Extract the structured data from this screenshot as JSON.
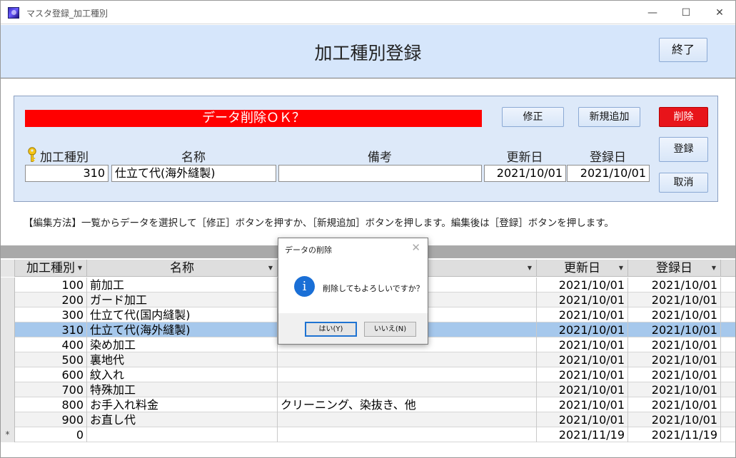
{
  "window": {
    "title": "マスタ登録_加工種別",
    "minimize": "—",
    "maximize": "☐",
    "close": "✕"
  },
  "header": {
    "title": "加工種別登録",
    "end_button": "終了"
  },
  "edit": {
    "status": "データ削除ＯＫ？",
    "buttons": {
      "fix": "修正",
      "new": "新規追加",
      "delete": "削除",
      "register": "登録",
      "cancel": "取消"
    },
    "labels": {
      "type": "加工種別",
      "name": "名称",
      "note": "備考",
      "updated": "更新日",
      "registered": "登録日"
    },
    "values": {
      "type": "310",
      "name": "仕立て代(海外縫製)",
      "note": "",
      "updated": "2021/10/01",
      "registered": "2021/10/01"
    }
  },
  "help_text": "【編集方法】一覧からデータを選択して［修正］ボタンを押すか、［新規追加］ボタンを押します。編集後は［登録］ボタンを押します。",
  "grid": {
    "headers": {
      "type": "加工種別",
      "name": "名称",
      "note": "",
      "updated": "更新日",
      "registered": "登録日"
    },
    "rows": [
      {
        "type": "100",
        "name": "前加工",
        "note": "",
        "updated": "2021/10/01",
        "registered": "2021/10/01"
      },
      {
        "type": "200",
        "name": "ガード加工",
        "note": "",
        "updated": "2021/10/01",
        "registered": "2021/10/01"
      },
      {
        "type": "300",
        "name": "仕立て代(国内縫製)",
        "note": "",
        "updated": "2021/10/01",
        "registered": "2021/10/01"
      },
      {
        "type": "310",
        "name": "仕立て代(海外縫製)",
        "note": "",
        "updated": "2021/10/01",
        "registered": "2021/10/01"
      },
      {
        "type": "400",
        "name": "染め加工",
        "note": "",
        "updated": "2021/10/01",
        "registered": "2021/10/01"
      },
      {
        "type": "500",
        "name": "裏地代",
        "note": "",
        "updated": "2021/10/01",
        "registered": "2021/10/01"
      },
      {
        "type": "600",
        "name": "紋入れ",
        "note": "",
        "updated": "2021/10/01",
        "registered": "2021/10/01"
      },
      {
        "type": "700",
        "name": "特殊加工",
        "note": "",
        "updated": "2021/10/01",
        "registered": "2021/10/01"
      },
      {
        "type": "800",
        "name": "お手入れ料金",
        "note": "クリーニング、染抜き、他",
        "updated": "2021/10/01",
        "registered": "2021/10/01"
      },
      {
        "type": "900",
        "name": "お直し代",
        "note": "",
        "updated": "2021/10/01",
        "registered": "2021/10/01"
      },
      {
        "type": "0",
        "name": "",
        "note": "",
        "updated": "2021/11/19",
        "registered": "2021/11/19",
        "marker": "*"
      }
    ],
    "selected_index": 3
  },
  "dialog": {
    "title": "データの削除",
    "message": "削除してもよろしいですか？",
    "yes": "はい(Y)",
    "no": "いいえ(N)",
    "close": "✕",
    "icon": "i"
  },
  "colors": {
    "header_band": "#d6e6fb",
    "delete_red": "#e8141a",
    "status_red": "#ff0000",
    "selected_row": "#a6c8ec"
  }
}
